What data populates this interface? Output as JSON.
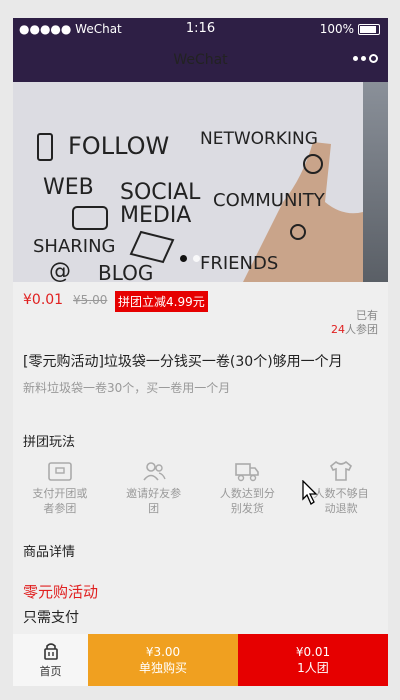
{
  "status_bar": {
    "carrier": "●●●●● WeChat",
    "time": "1:16",
    "battery": "100%"
  },
  "nav": {
    "title": "WeChat"
  },
  "banner": {
    "words": [
      "FOLLOW",
      "NETWORKING",
      "WEB",
      "SOCIAL",
      "MEDIA",
      "COMMUNITY",
      "SHARING",
      "@",
      "BLOG",
      "FRIENDS"
    ],
    "dot_count": 2,
    "active_dot": 0
  },
  "product": {
    "price": "¥0.01",
    "original_price": "¥5.00",
    "group_discount": "拼团立减4.99元",
    "joined_prefix": "已有",
    "joined_count": "24",
    "joined_suffix": "人参团",
    "title": "[零元购活动]垃圾袋一分钱买一卷(30个)够用一个月",
    "subtitle": "新料垃圾袋一卷30个，买一卷用一个月"
  },
  "group_rules": {
    "heading": "拼团玩法",
    "steps": [
      {
        "label_line1": "支付开团或",
        "label_line2": "者参团",
        "icon": "wallet-icon"
      },
      {
        "label_line1": "邀请好友参",
        "label_line2": "团",
        "icon": "users-icon"
      },
      {
        "label_line1": "人数达到分",
        "label_line2": "别发货",
        "icon": "truck-icon"
      },
      {
        "label_line1": "人数不够自",
        "label_line2": "动退款",
        "icon": "shirt-icon"
      }
    ]
  },
  "details": {
    "heading": "商品详情",
    "promo_heading": "零元购活动",
    "line1": "只需支付"
  },
  "bottom_bar": {
    "home_label": "首页",
    "solo_price": "¥3.00",
    "solo_label": "单独购买",
    "group_price": "¥0.01",
    "group_label": "1人团"
  },
  "colors": {
    "nav_bg": "#2e1f45",
    "accent_red": "#e60000",
    "solo_orange": "#f0a020"
  }
}
